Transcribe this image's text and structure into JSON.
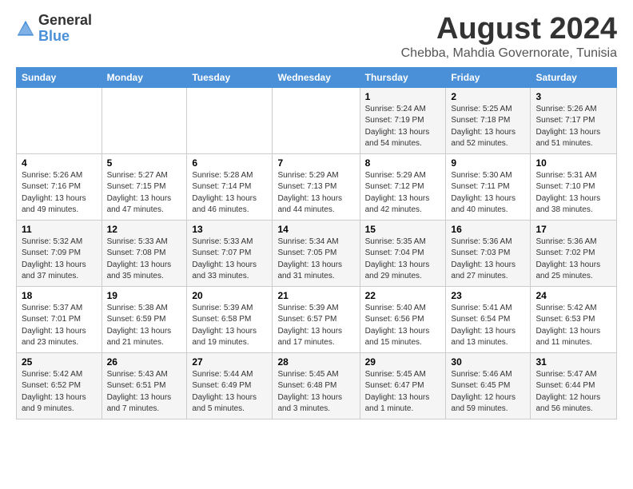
{
  "logo": {
    "general": "General",
    "blue": "Blue"
  },
  "title": {
    "month_year": "August 2024",
    "location": "Chebba, Mahdia Governorate, Tunisia"
  },
  "header_days": [
    "Sunday",
    "Monday",
    "Tuesday",
    "Wednesday",
    "Thursday",
    "Friday",
    "Saturday"
  ],
  "weeks": [
    [
      {
        "day": "",
        "info": ""
      },
      {
        "day": "",
        "info": ""
      },
      {
        "day": "",
        "info": ""
      },
      {
        "day": "",
        "info": ""
      },
      {
        "day": "1",
        "info": "Sunrise: 5:24 AM\nSunset: 7:19 PM\nDaylight: 13 hours\nand 54 minutes."
      },
      {
        "day": "2",
        "info": "Sunrise: 5:25 AM\nSunset: 7:18 PM\nDaylight: 13 hours\nand 52 minutes."
      },
      {
        "day": "3",
        "info": "Sunrise: 5:26 AM\nSunset: 7:17 PM\nDaylight: 13 hours\nand 51 minutes."
      }
    ],
    [
      {
        "day": "4",
        "info": "Sunrise: 5:26 AM\nSunset: 7:16 PM\nDaylight: 13 hours\nand 49 minutes."
      },
      {
        "day": "5",
        "info": "Sunrise: 5:27 AM\nSunset: 7:15 PM\nDaylight: 13 hours\nand 47 minutes."
      },
      {
        "day": "6",
        "info": "Sunrise: 5:28 AM\nSunset: 7:14 PM\nDaylight: 13 hours\nand 46 minutes."
      },
      {
        "day": "7",
        "info": "Sunrise: 5:29 AM\nSunset: 7:13 PM\nDaylight: 13 hours\nand 44 minutes."
      },
      {
        "day": "8",
        "info": "Sunrise: 5:29 AM\nSunset: 7:12 PM\nDaylight: 13 hours\nand 42 minutes."
      },
      {
        "day": "9",
        "info": "Sunrise: 5:30 AM\nSunset: 7:11 PM\nDaylight: 13 hours\nand 40 minutes."
      },
      {
        "day": "10",
        "info": "Sunrise: 5:31 AM\nSunset: 7:10 PM\nDaylight: 13 hours\nand 38 minutes."
      }
    ],
    [
      {
        "day": "11",
        "info": "Sunrise: 5:32 AM\nSunset: 7:09 PM\nDaylight: 13 hours\nand 37 minutes."
      },
      {
        "day": "12",
        "info": "Sunrise: 5:33 AM\nSunset: 7:08 PM\nDaylight: 13 hours\nand 35 minutes."
      },
      {
        "day": "13",
        "info": "Sunrise: 5:33 AM\nSunset: 7:07 PM\nDaylight: 13 hours\nand 33 minutes."
      },
      {
        "day": "14",
        "info": "Sunrise: 5:34 AM\nSunset: 7:05 PM\nDaylight: 13 hours\nand 31 minutes."
      },
      {
        "day": "15",
        "info": "Sunrise: 5:35 AM\nSunset: 7:04 PM\nDaylight: 13 hours\nand 29 minutes."
      },
      {
        "day": "16",
        "info": "Sunrise: 5:36 AM\nSunset: 7:03 PM\nDaylight: 13 hours\nand 27 minutes."
      },
      {
        "day": "17",
        "info": "Sunrise: 5:36 AM\nSunset: 7:02 PM\nDaylight: 13 hours\nand 25 minutes."
      }
    ],
    [
      {
        "day": "18",
        "info": "Sunrise: 5:37 AM\nSunset: 7:01 PM\nDaylight: 13 hours\nand 23 minutes."
      },
      {
        "day": "19",
        "info": "Sunrise: 5:38 AM\nSunset: 6:59 PM\nDaylight: 13 hours\nand 21 minutes."
      },
      {
        "day": "20",
        "info": "Sunrise: 5:39 AM\nSunset: 6:58 PM\nDaylight: 13 hours\nand 19 minutes."
      },
      {
        "day": "21",
        "info": "Sunrise: 5:39 AM\nSunset: 6:57 PM\nDaylight: 13 hours\nand 17 minutes."
      },
      {
        "day": "22",
        "info": "Sunrise: 5:40 AM\nSunset: 6:56 PM\nDaylight: 13 hours\nand 15 minutes."
      },
      {
        "day": "23",
        "info": "Sunrise: 5:41 AM\nSunset: 6:54 PM\nDaylight: 13 hours\nand 13 minutes."
      },
      {
        "day": "24",
        "info": "Sunrise: 5:42 AM\nSunset: 6:53 PM\nDaylight: 13 hours\nand 11 minutes."
      }
    ],
    [
      {
        "day": "25",
        "info": "Sunrise: 5:42 AM\nSunset: 6:52 PM\nDaylight: 13 hours\nand 9 minutes."
      },
      {
        "day": "26",
        "info": "Sunrise: 5:43 AM\nSunset: 6:51 PM\nDaylight: 13 hours\nand 7 minutes."
      },
      {
        "day": "27",
        "info": "Sunrise: 5:44 AM\nSunset: 6:49 PM\nDaylight: 13 hours\nand 5 minutes."
      },
      {
        "day": "28",
        "info": "Sunrise: 5:45 AM\nSunset: 6:48 PM\nDaylight: 13 hours\nand 3 minutes."
      },
      {
        "day": "29",
        "info": "Sunrise: 5:45 AM\nSunset: 6:47 PM\nDaylight: 13 hours\nand 1 minute."
      },
      {
        "day": "30",
        "info": "Sunrise: 5:46 AM\nSunset: 6:45 PM\nDaylight: 12 hours\nand 59 minutes."
      },
      {
        "day": "31",
        "info": "Sunrise: 5:47 AM\nSunset: 6:44 PM\nDaylight: 12 hours\nand 56 minutes."
      }
    ]
  ]
}
